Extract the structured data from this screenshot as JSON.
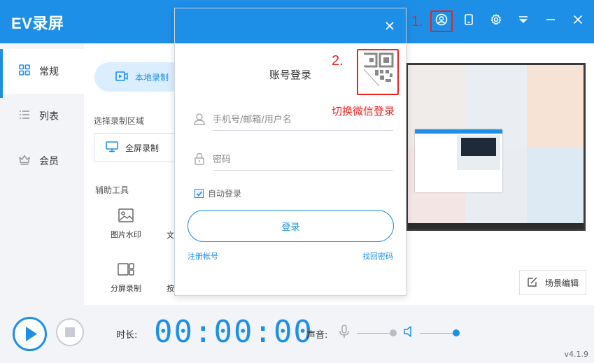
{
  "app": {
    "title": "EV录屏",
    "version": "v4.1.9"
  },
  "colors": {
    "brand": "#1e8fe6",
    "annotation": "#e8231f",
    "sidebar_bg": "#f2f4f7"
  },
  "titlebar": {
    "buttons": [
      {
        "icon": "user-icon"
      },
      {
        "icon": "tablet-icon"
      },
      {
        "icon": "gear-icon"
      },
      {
        "icon": "dropdown-icon"
      },
      {
        "icon": "minimize-icon"
      },
      {
        "icon": "close-icon"
      }
    ]
  },
  "sidebar": {
    "items": [
      {
        "label": "常规",
        "icon": "grid-icon",
        "active": true
      },
      {
        "label": "列表",
        "icon": "list-icon",
        "active": false
      },
      {
        "label": "会员",
        "icon": "crown-icon",
        "active": false
      }
    ]
  },
  "main": {
    "tab_local": "本地录制",
    "area_label": "选择录制区域",
    "fullscreen_label": "全屏录制",
    "tools_label": "辅助工具",
    "tools": [
      {
        "label": "图片水印",
        "icon": "image-icon"
      },
      {
        "label": "文",
        "icon": "text-icon"
      },
      {
        "label": "分屏录制",
        "icon": "split-screen-icon"
      },
      {
        "label": "按",
        "icon": "key-icon"
      }
    ],
    "scene_edit": "场景编辑"
  },
  "bottom": {
    "duration_label": "时长:",
    "timer": "00:00:00",
    "sound_label": "声音:",
    "mic_level": 0.95,
    "speaker_level": 0.95
  },
  "login_dialog": {
    "title": "账号登录",
    "account_placeholder": "手机号/邮箱/用户名",
    "password_placeholder": "密码",
    "auto_login_label": "自动登录",
    "auto_login_checked": true,
    "login_button": "登录",
    "register_link": "注册帐号",
    "forgot_link": "找回密码"
  },
  "annotations": {
    "step1": "1.",
    "step2": "2.",
    "caption": "切换微信登录"
  }
}
